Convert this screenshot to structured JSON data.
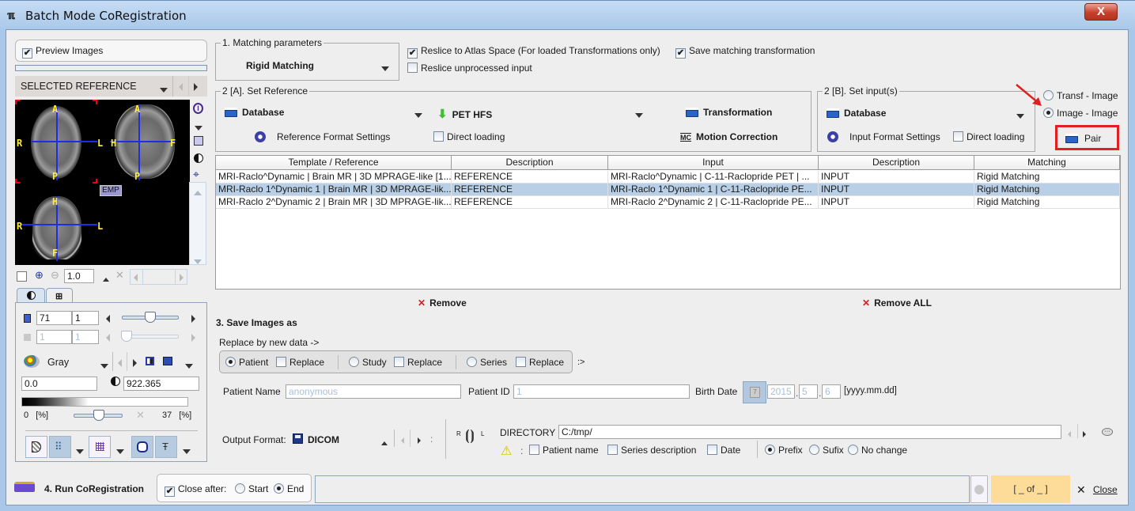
{
  "window": {
    "title": "Batch Mode CoRegistration",
    "app_icon": "pmod-icon",
    "close_glyph": "X"
  },
  "preview": {
    "checkbox_label": "Preview Images",
    "checked": true,
    "selector_label": "SELECTED REFERENCE",
    "empty_badge": "EMP",
    "zoom_value": "1.0",
    "orientation_labels": {
      "axial": {
        "top": "A",
        "bottom": "P",
        "left": "R",
        "right": "L"
      },
      "sagittal": {
        "top": "A",
        "bottom": "P",
        "left": "H",
        "right": "F"
      },
      "coronal": {
        "top": "H",
        "bottom": "F",
        "left": "R",
        "right": "L"
      }
    }
  },
  "image_controls": {
    "tabs": [
      "contrast-tab",
      "layout-tab"
    ],
    "slice_value": "71",
    "slice_step": "1",
    "slice_slider_fraction": 0.6,
    "frame_value": "1",
    "frame_step": "1",
    "colormap": "Gray",
    "min_value": "0.0",
    "max_value": "922.365",
    "lower_pct": "0",
    "upper_pct": "37",
    "pct_unit": "[%]",
    "threshold_slider_fraction": 0.5
  },
  "matching": {
    "legend": "1. Matching parameters",
    "method": "Rigid Matching",
    "reslice_atlas_label": "Reslice to Atlas Space (For loaded Transformations only)",
    "reslice_atlas_checked": true,
    "save_transform_label": "Save matching transformation",
    "save_transform_checked": true,
    "reslice_unprocessed_label": "Reslice unprocessed input",
    "reslice_unprocessed_checked": false
  },
  "reference": {
    "legend": "2 [A]. Set Reference",
    "source": "Database",
    "orientation": "PET HFS",
    "transformation_label": "Transformation",
    "format_settings_label": "Reference Format Settings",
    "direct_loading_label": "Direct loading",
    "direct_loading_checked": false,
    "motion_correction_label": "Motion Correction"
  },
  "input": {
    "legend": "2 [B]. Set input(s)",
    "source": "Database",
    "format_settings_label": "Input Format Settings",
    "direct_loading_label": "Direct loading",
    "direct_loading_checked": false
  },
  "mode": {
    "options": [
      "Transf - Image",
      "Image - Image"
    ],
    "selected": "Image - Image",
    "pair_label": "Pair"
  },
  "table": {
    "columns": [
      "Template / Reference",
      "Description",
      "Input",
      "Description",
      "Matching"
    ],
    "rows": [
      [
        "MRI-Raclo^Dynamic | Brain MR | 3D MPRAGE-like [1...",
        "REFERENCE",
        "MRI-Raclo^Dynamic | C-11-Raclopride PET | ...",
        "INPUT",
        "Rigid Matching"
      ],
      [
        "MRI-Raclo 1^Dynamic 1 | Brain MR | 3D MPRAGE-lik...",
        "REFERENCE",
        "MRI-Raclo 1^Dynamic 1 | C-11-Raclopride PE...",
        "INPUT",
        "Rigid Matching"
      ],
      [
        "MRI-Raclo 2^Dynamic 2 | Brain MR | 3D MPRAGE-lik...",
        "REFERENCE",
        "MRI-Raclo 2^Dynamic 2 | C-11-Raclopride PE...",
        "INPUT",
        "Rigid Matching"
      ]
    ],
    "selected_row": 1,
    "remove_label": "Remove",
    "remove_all_label": "Remove ALL"
  },
  "save": {
    "heading": "3. Save Images as",
    "replace_label": "Replace by new data ->",
    "levels": [
      {
        "label": "Patient",
        "selected": true,
        "replace_label": "Replace",
        "replace_checked": false
      },
      {
        "label": "Study",
        "selected": false,
        "replace_label": "Replace",
        "replace_checked": false
      },
      {
        "label": "Series",
        "selected": false,
        "replace_label": "Replace",
        "replace_checked": false
      }
    ],
    "suffix_glyph": ":>",
    "patient_name_label": "Patient Name",
    "patient_name_value": "anonymous",
    "patient_id_label": "Patient ID",
    "patient_id_value": "1",
    "birth_date_label": "Birth Date",
    "birth_year": "2015",
    "birth_month": "5",
    "birth_day": "6",
    "date_format": "[yyyy.mm.dd]",
    "output_format_label": "Output Format:",
    "output_format": "DICOM",
    "orientation_r": "R",
    "orientation_l": "L",
    "directory_label": "DIRECTORY",
    "directory_value": "C:/tmp/",
    "colon": ":",
    "naming_options": [
      {
        "label": "Patient name",
        "checked": false
      },
      {
        "label": "Series description",
        "checked": false
      },
      {
        "label": "Date",
        "checked": false
      }
    ],
    "position_options": [
      "Prefix",
      "Sufix",
      "No change"
    ],
    "position_selected": "Prefix"
  },
  "run": {
    "label": "4. Run CoRegistration",
    "close_after_label": "Close after:",
    "close_after_checked": true,
    "close_after_options": [
      "Start",
      "End"
    ],
    "close_after_selected": "End",
    "counter": "[ _ of _ ]",
    "close_label": "Close"
  },
  "colors": {
    "accent_highlight": "#e02020",
    "selected_row": "#b8cfe5",
    "counter_bg": "#fddc9a"
  }
}
